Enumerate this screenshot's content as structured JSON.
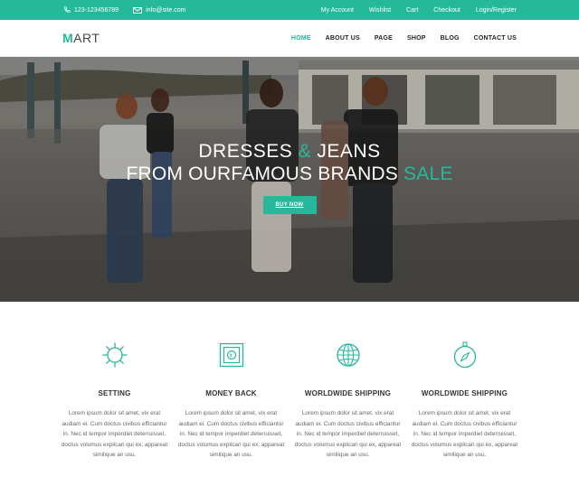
{
  "topbar": {
    "phone": "123-123456789",
    "email": "info@site.com",
    "links": [
      "My Account",
      "Wishlist",
      "Cart",
      "Checkout",
      "Login/Register"
    ],
    "bg_color": "#26b89b"
  },
  "header": {
    "logo_first": "M",
    "logo_rest": "ART",
    "nav": [
      "HOME",
      "ABOUT US",
      "PAGE",
      "SHOP",
      "BLOG",
      "CONTACT US"
    ],
    "active": "HOME"
  },
  "hero": {
    "line1_a": "DRESSES ",
    "line1_amp": "&",
    "line1_b": " JEANS",
    "line2_a": "FROM OURFAMOUS BRANDS ",
    "line2_b": "SALE",
    "button": "BUY NOW"
  },
  "features": [
    {
      "icon": "gear-icon",
      "title": "SETTING",
      "text": "Lorem ipsum dolor sit amet, vix erat audiam ei. Cum doctus civibus efficiantur in. Nec id tempor imperdiet deterruisset, doctus volumus explicari qui ex, appareat similique an usu."
    },
    {
      "icon": "money-back-icon",
      "title": "MONEY BACK",
      "text": "Lorem ipsum dolor sit amet, vix erat audiam ei. Cum doctus civibus efficiantur in. Nec id tempor imperdiet deterruisset, doctus volumus explicari qui ex, appareat similique an usu."
    },
    {
      "icon": "globe-icon",
      "title": "WORLDWIDE SHIPPING",
      "text": "Lorem ipsum dolor sit amet, vix erat audiam ei. Cum doctus civibus efficiantur in. Nec id tempor imperdiet deterruisset, doctus volumus explicari qui ex, appareat similique an usu."
    },
    {
      "icon": "compass-icon",
      "title": "WORLDWIDE SHIPPING",
      "text": "Lorem ipsum dolor sit amet, vix erat audiam ei. Cum doctus civibus efficiantur in. Nec id tempor imperdiet deterruisset, doctus volumus explicari qui ex, appareat similique an usu."
    }
  ],
  "accent_color": "#26b89b"
}
